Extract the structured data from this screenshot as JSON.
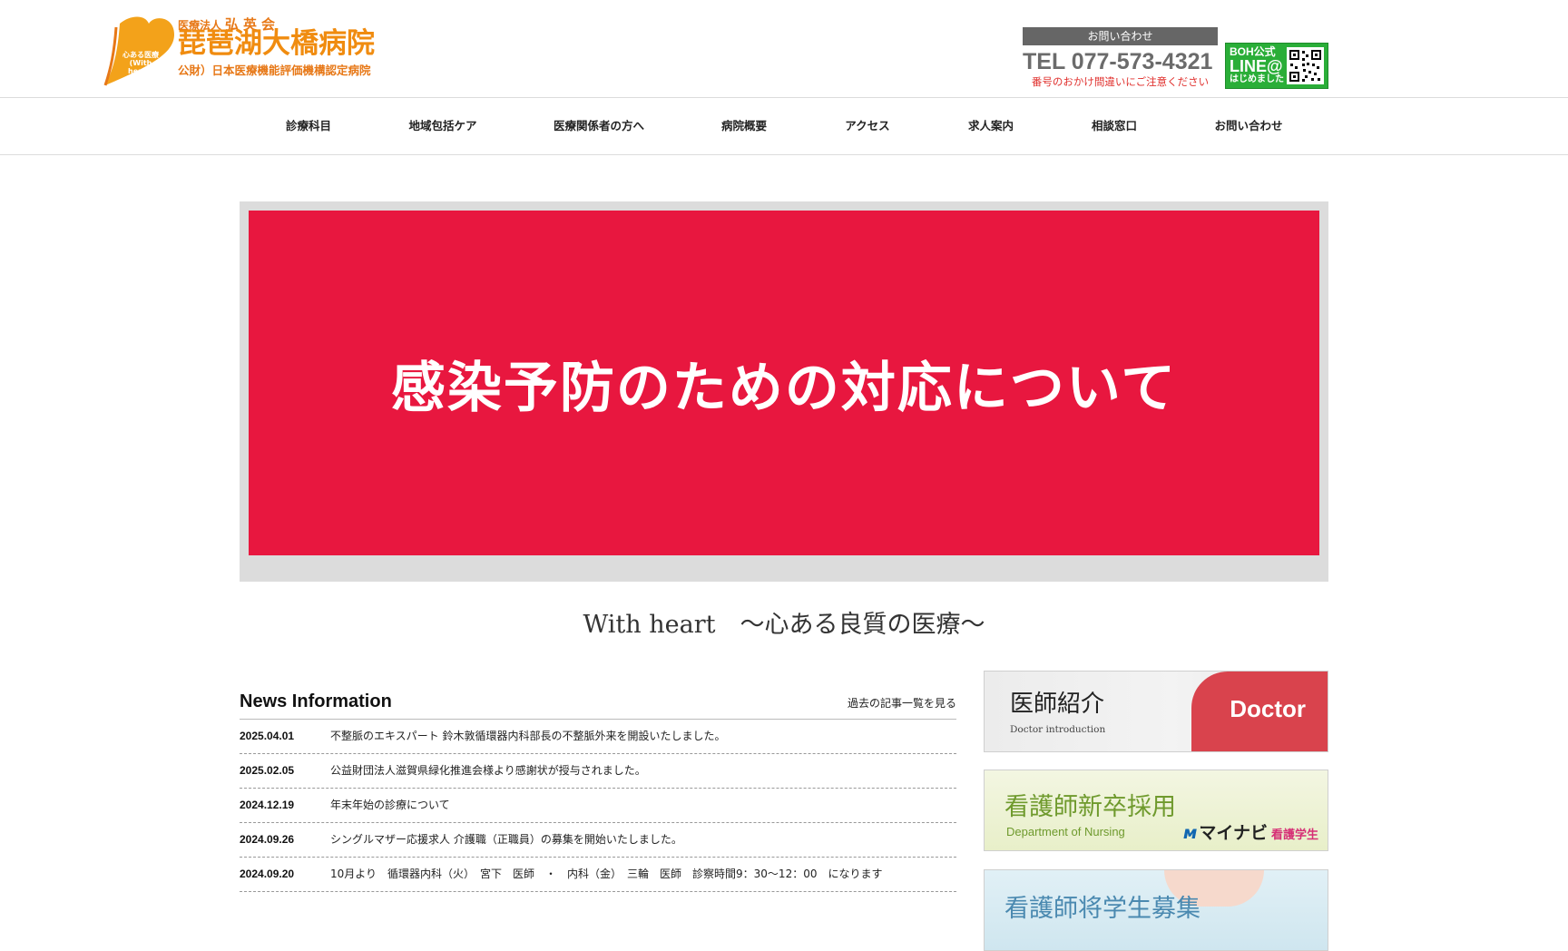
{
  "header": {
    "logo": {
      "mark_text": [
        "心ある医療",
        "(With heart)"
      ],
      "corp_small": "医療法人",
      "corp_big": "弘英会",
      "name": "琵琶湖大橋病院",
      "cert": "公財）日本医療機能評価機構認定病院",
      "brand_color": "#f08c10"
    },
    "contact": {
      "label": "お問い合わせ",
      "tel": "TEL 077-573-4321",
      "note": "番号のおかけ間違いにご注意ください"
    },
    "line_badge": {
      "line1": "BOH公式",
      "line2": "LINE@",
      "line3": "はじめました",
      "color": "#2aae38",
      "icon": "qr-code-icon"
    }
  },
  "nav": {
    "items": [
      "診療科目",
      "地域包括ケア",
      "医療関係者の方へ",
      "病院概要",
      "アクセス",
      "求人案内",
      "相談窓口",
      "お問い合わせ"
    ]
  },
  "hero": {
    "text": "感染予防のための対応について",
    "color": "#e8173f"
  },
  "tagline": "With heart　～心ある良質の医療～",
  "news": {
    "title": "News Information",
    "more_link": "過去の記事一覧を見る",
    "items": [
      {
        "date": "2025.04.01",
        "text": "不整脈のエキスパート 鈴木敦循環器内科部長の不整脈外来を開設いたしました。"
      },
      {
        "date": "2025.02.05",
        "text": "公益財団法人滋賀県緑化推進会様より感謝状が授与されました。"
      },
      {
        "date": "2024.12.19",
        "text": "年末年始の診療について"
      },
      {
        "date": "2024.09.26",
        "text": "シングルマザー応援求人 介護職（正職員）の募集を開始いたしました。"
      },
      {
        "date": "2024.09.20",
        "text": "10月より　循環器内科（火）　宮下　医師　・　内科（金）　三輪　医師　診察時間9：30～12：00　になります"
      }
    ]
  },
  "banners": {
    "doctor": {
      "title": "医師紹介",
      "subtitle": "Doctor introduction",
      "puzzle_word": "Doctor"
    },
    "nursing": {
      "title": "看護師新卒採用",
      "subtitle": "Department of Nursing",
      "brand": "マイナビ",
      "brand_sub": "看護学生"
    },
    "scholarship": {
      "title": "看護師将学生募集"
    }
  }
}
